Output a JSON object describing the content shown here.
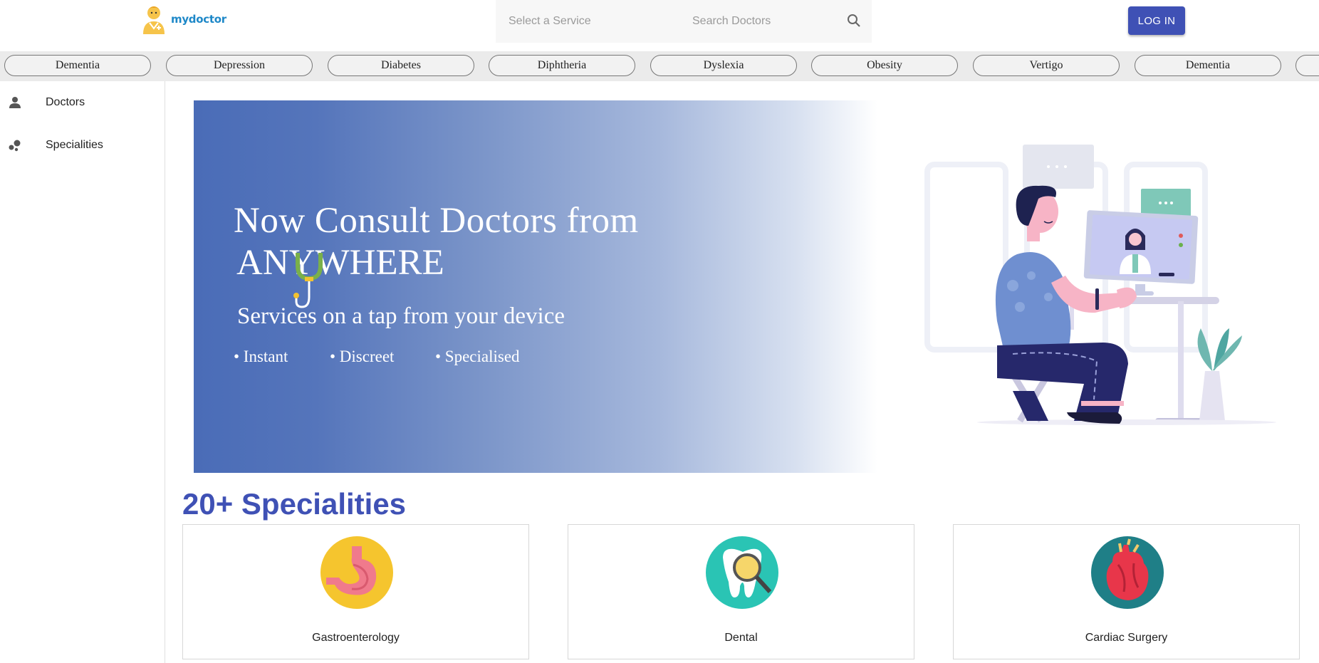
{
  "header": {
    "logo_text": "mydoctor",
    "search_service_placeholder": "Select a Service",
    "search_doctors_placeholder": "Search Doctors",
    "login_label": "LOG IN"
  },
  "chips": [
    "Dementia",
    "Depression",
    "Diabetes",
    "Diphtheria",
    "Dyslexia",
    "Obesity",
    "Vertigo",
    "Dementia"
  ],
  "sidebar": {
    "items": [
      {
        "label": "Doctors",
        "icon": "person-icon"
      },
      {
        "label": "Specialities",
        "icon": "bubbles-icon"
      }
    ]
  },
  "banner": {
    "title_line1": "Now Consult Doctors from",
    "title_line2": "ANYWHERE",
    "subtitle": "Services on a tap from your device",
    "bullets": [
      "• Instant",
      "• Discreet",
      "• Specialised"
    ]
  },
  "specialities": {
    "heading": "20+ Specialities",
    "cards": [
      {
        "label": "Gastroenterology",
        "icon": "stomach-icon"
      },
      {
        "label": "Dental",
        "icon": "tooth-magnifier-icon"
      },
      {
        "label": "Cardiac Surgery",
        "icon": "heart-icon"
      }
    ]
  },
  "colors": {
    "accent": "#3f51b5",
    "banner_start": "#4a6cb7",
    "chip_bar": "#ebebeb"
  }
}
